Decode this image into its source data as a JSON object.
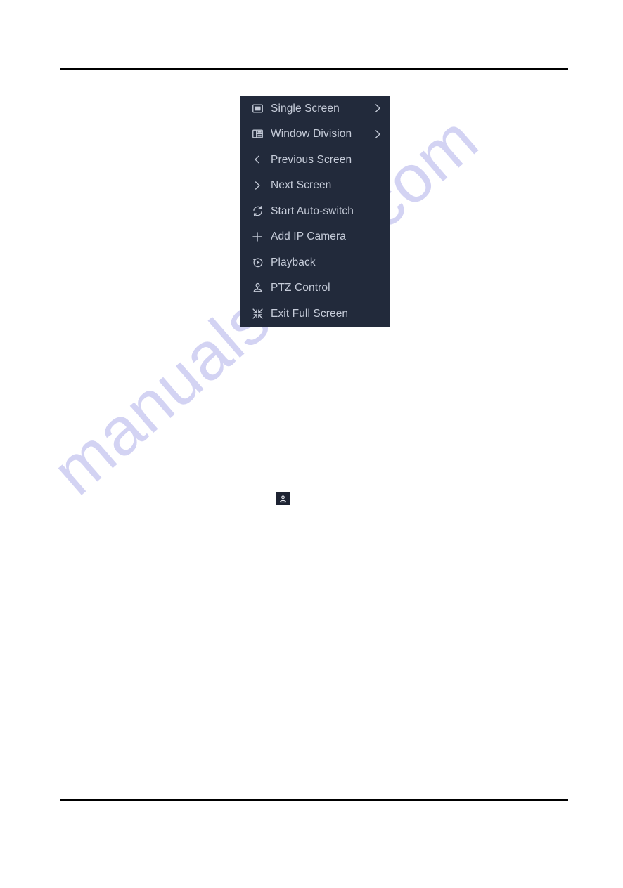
{
  "document": {
    "background_color": "#ffffff",
    "rules": {
      "top_rule_label": "header-rule",
      "bottom_rule_label": "footer-rule",
      "color": "#000000"
    },
    "watermark": {
      "text": "manualshive.com",
      "color": "#ccccf2"
    }
  },
  "context_menu": {
    "name": "live-view-right-click-menu",
    "background_color": "#222a3b",
    "text_color": "#c6ccd9",
    "items": [
      {
        "label": "Single Screen",
        "icon": "single-screen-icon",
        "has_submenu": true,
        "arrow": "chevron-right-icon"
      },
      {
        "label": "Window Division",
        "icon": "window-division-icon",
        "has_submenu": true,
        "arrow": "chevron-right-icon"
      },
      {
        "label": "Previous Screen",
        "icon": "chevron-left-icon",
        "has_submenu": false,
        "arrow": ""
      },
      {
        "label": "Next Screen",
        "icon": "chevron-right-icon",
        "has_submenu": false,
        "arrow": ""
      },
      {
        "label": "Start Auto-switch",
        "icon": "auto-switch-icon",
        "has_submenu": false,
        "arrow": ""
      },
      {
        "label": "Add IP Camera",
        "icon": "plus-icon",
        "has_submenu": false,
        "arrow": ""
      },
      {
        "label": "Playback",
        "icon": "playback-icon",
        "has_submenu": false,
        "arrow": ""
      },
      {
        "label": "PTZ Control",
        "icon": "ptz-control-icon",
        "has_submenu": false,
        "arrow": ""
      },
      {
        "label": "Exit Full Screen",
        "icon": "exit-full-screen-icon",
        "has_submenu": false,
        "arrow": ""
      }
    ]
  },
  "inline_icon": {
    "name": "ptz-control-icon-inline",
    "background_color": "#1d2332",
    "glyph_color": "#e8eaf0"
  }
}
